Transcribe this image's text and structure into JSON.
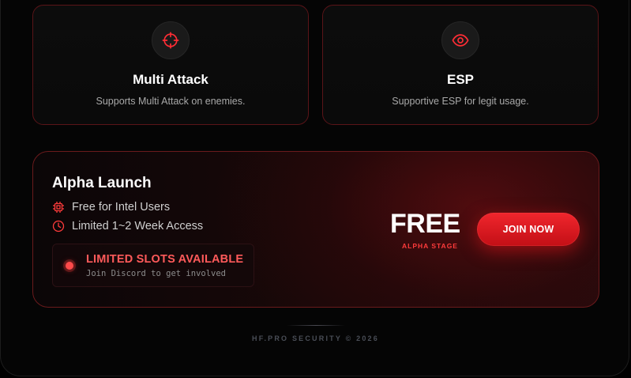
{
  "features": [
    {
      "icon": "crosshair-icon",
      "title": "Multi Attack",
      "desc": "Supports Multi Attack on enemies."
    },
    {
      "icon": "eye-icon",
      "title": "ESP",
      "desc": "Supportive ESP for legit usage."
    }
  ],
  "promo": {
    "title": "Alpha Launch",
    "perks": [
      {
        "icon": "cpu-chip-icon",
        "label": "Free for Intel Users"
      },
      {
        "icon": "clock-icon",
        "label": "Limited 1~2 Week Access"
      }
    ],
    "slots": {
      "title": "LIMITED SLOTS AVAILABLE",
      "subtitle": "Join Discord to get involved"
    },
    "price": "FREE",
    "stage": "ALPHA STAGE",
    "cta": "JOIN NOW"
  },
  "footer": "HF.PRO SECURITY © 2026",
  "colors": {
    "accent": "#e51a22",
    "accent_text": "#ff5a5a",
    "background": "#050505"
  }
}
